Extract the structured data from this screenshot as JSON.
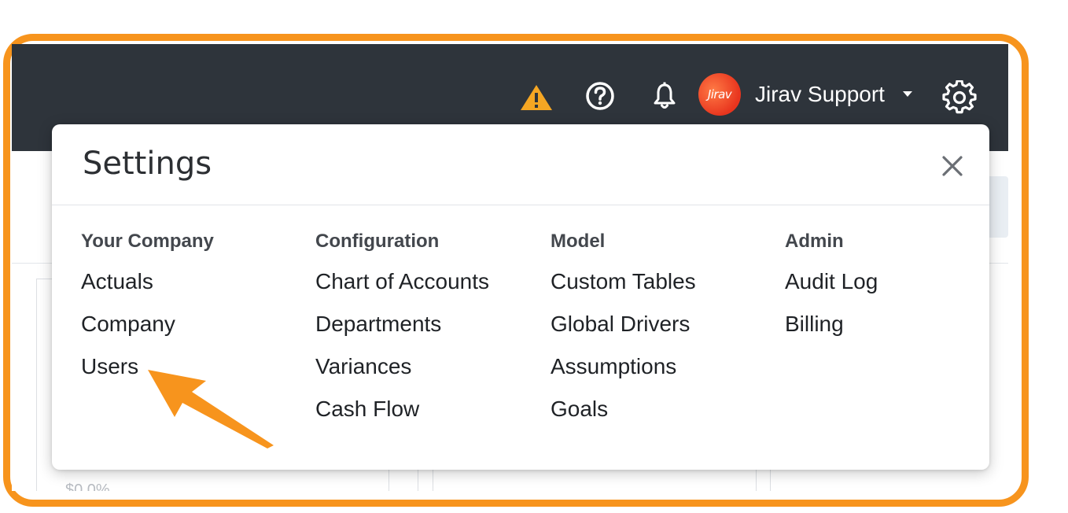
{
  "header": {
    "user_name": "Jirav Support",
    "avatar_text": "Jirav",
    "icons": [
      "warning-icon",
      "help-icon",
      "bell-icon",
      "caret-down-icon",
      "gear-icon"
    ]
  },
  "background": {
    "partial_value": "$0   0%"
  },
  "settings": {
    "title": "Settings",
    "close_icon": "close-icon",
    "columns": [
      {
        "heading": "Your Company",
        "items": [
          "Actuals",
          "Company",
          "Users"
        ]
      },
      {
        "heading": "Configuration",
        "items": [
          "Chart of Accounts",
          "Departments",
          "Variances",
          "Cash Flow"
        ]
      },
      {
        "heading": "Model",
        "items": [
          "Custom Tables",
          "Global Drivers",
          "Assumptions",
          "Goals"
        ]
      },
      {
        "heading": "Admin",
        "items": [
          "Audit Log",
          "Billing"
        ]
      }
    ]
  },
  "colors": {
    "highlight": "#f7941d",
    "topbar": "#2e343b",
    "warning": "#f5a623",
    "avatar": "#e8351e"
  }
}
